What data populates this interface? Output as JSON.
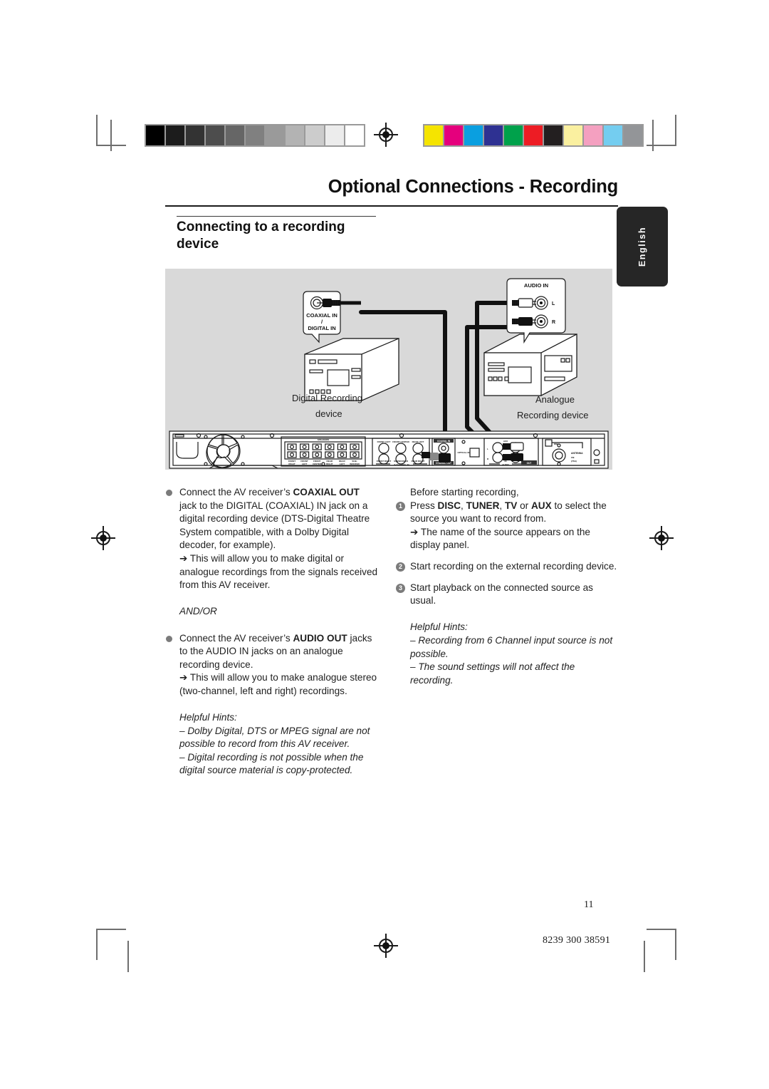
{
  "header": {
    "title": "Optional Connections - Recording",
    "subtitle": "Connecting to a recording device",
    "language_tab": "English"
  },
  "figure": {
    "digital_device_label_line1": "Digital Recording",
    "digital_device_label_line2": "device",
    "analogue_device_label_line1": "Analogue",
    "analogue_device_label_line2": "Recording device",
    "callout_coaxial_line1": "COAXIAL IN",
    "callout_coaxial_line2": "/",
    "callout_coaxial_line3": "DIGITAL IN",
    "callout_audio_in": "AUDIO IN",
    "jack_left": "L",
    "jack_right": "R",
    "rear_panel": {
      "speaker_block_title": "SPEAKERS",
      "speaker_labels_top": [
        "FRONT",
        "FRONT",
        "FRONT",
        "REAR",
        "REAR",
        "SUB-"
      ],
      "speaker_labels_bottom": [
        "RIGHT",
        "LEFT",
        "CENTER",
        "RIGHT",
        "LEFT",
        "WOOFER"
      ],
      "six_channel_title": "6-CHANNEL IN",
      "six_channel_top": [
        "FRONT LEFT",
        "FRONT CENTER",
        "REAR LEFT"
      ],
      "six_channel_bottom": [
        "FRONT RIGHT",
        "SUBWOOFER",
        "REAR RIGHT"
      ],
      "coaxial_in": "COAXIAL IN",
      "coaxial_out": "COAXIAL OUT",
      "optical_in": "OPTICAL IN",
      "audio_title": "AUDIO",
      "audio_aux": "AUX",
      "audio_in": "IN",
      "audio_out": "OUT",
      "audio_l": "L",
      "audio_r": "R",
      "antenna_title": "ANTENNA",
      "antenna_fm": "FM",
      "antenna_fm_ohm": "(75Ω)",
      "antenna_mw": "MW"
    }
  },
  "left_column": {
    "bullet1_pre": "Connect the AV receiver’s ",
    "bullet1_b1": "COAXIAL OUT",
    "bullet1_post": " jack to the DIGITAL (COAXIAL) IN jack on a digital recording device (DTS-Digital Theatre System compatible, with a Dolby Digital decoder, for example).",
    "bullet1_arrow": "➔ This will allow you to make digital or analogue recordings from the signals received from this AV receiver.",
    "and_or": "AND/OR",
    "bullet2_pre": "Connect the AV receiver’s ",
    "bullet2_b1": "AUDIO OUT",
    "bullet2_post": " jacks to the AUDIO IN jacks on an analogue recording device.",
    "bullet2_arrow": "➔ This will allow you to make analogue stereo (two-channel, left and right) recordings.",
    "hints_heading": "Helpful Hints:",
    "hint1": "–  Dolby Digital, DTS or MPEG signal are not possible to record from this AV receiver.",
    "hint2": "–  Digital recording is not possible when the digital source material is copy-protected."
  },
  "right_column": {
    "intro": "Before starting recording,",
    "step1_num": "1",
    "step1_pre": "Press ",
    "step1_b1": "DISC",
    "step1_sep1": ", ",
    "step1_b2": "TUNER",
    "step1_sep2": ", ",
    "step1_b3": "TV",
    "step1_sep3": " or ",
    "step1_b4": "AUX",
    "step1_post": " to select the source you want to record from.",
    "step1_arrow": "➔ The name of the source appears on the display panel.",
    "step2_num": "2",
    "step2_text": "Start recording on the external recording device.",
    "step3_num": "3",
    "step3_text": "Start playback on the connected source as usual.",
    "hints_heading": "Helpful Hints:",
    "hint1": "–  Recording from 6 Channel input source is not possible.",
    "hint2": "–  The sound settings will not affect the recording."
  },
  "footer": {
    "page_number": "11",
    "document_code": "8239 300 38591"
  },
  "calibration": {
    "grayscale": [
      "#000000",
      "#1c1c1c",
      "#333333",
      "#4d4d4d",
      "#666666",
      "#808080",
      "#9a9a9a",
      "#b3b3b3",
      "#cccccc",
      "#ececec",
      "#ffffff"
    ],
    "colors": [
      "#f5e400",
      "#e5007d",
      "#0a9fe0",
      "#2e3192",
      "#00a14b",
      "#ed1c24",
      "#231f20",
      "#faf0a0",
      "#f4a0c0",
      "#74cdf0",
      "#939598"
    ]
  }
}
